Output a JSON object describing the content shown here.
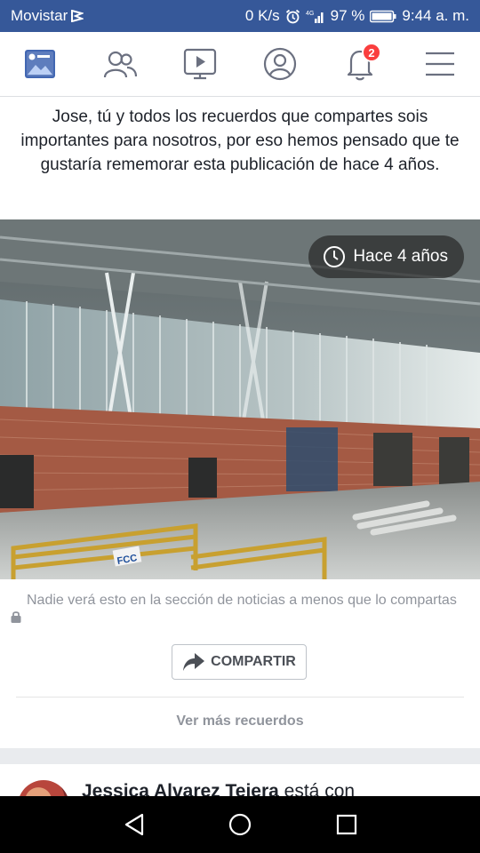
{
  "status_bar": {
    "carrier": "Movistar",
    "speed": "0 K/s",
    "battery": "97 %",
    "time": "9:44 a. m."
  },
  "nav": {
    "icons": [
      "news-feed-icon",
      "friends-icon",
      "watch-icon",
      "profile-icon",
      "notifications-icon",
      "menu-icon"
    ],
    "notification_count": "2",
    "active_color": "#4267b2"
  },
  "memory": {
    "message": "Jose, tú y todos los recuerdos que compartes sois importantes para nosotros, por eso hemos pensado que te gustaría rememorar esta publicación de hace 4 años.",
    "time_ago": "Hace 4 años",
    "privacy_note": "Nadie verá esto en la sección de noticias a menos que lo compartas",
    "share_label": "COMPARTIR",
    "more_memories": "Ver más recuerdos",
    "photo_sign": "FCC"
  },
  "next_post": {
    "author": "Jessica Alvarez Tejera",
    "action": " está con"
  },
  "colors": {
    "header_blue": "#365899",
    "badge_red": "#fa3e3e",
    "muted_text": "#90949c"
  }
}
